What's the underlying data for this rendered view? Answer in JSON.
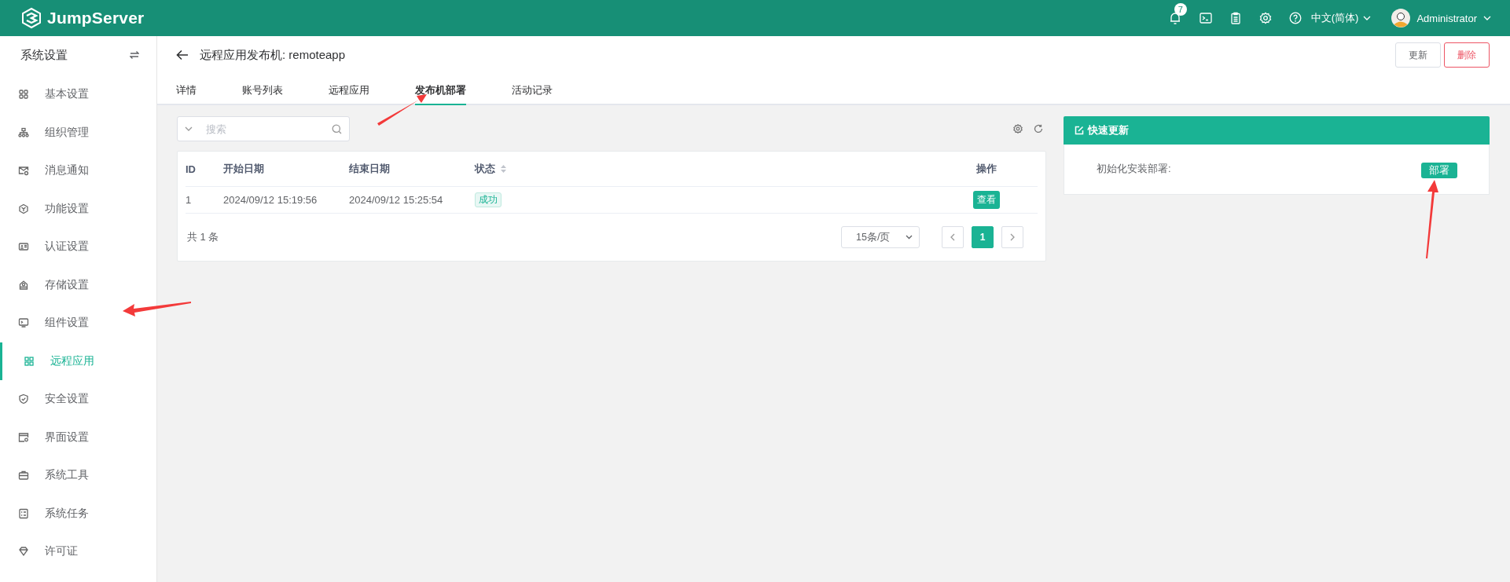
{
  "topbar": {
    "logo": "JumpServer",
    "notification_count": "7",
    "language": "中文(简体)",
    "user": "Administrator"
  },
  "sidebar": {
    "title": "系统设置",
    "items": [
      {
        "label": "基本设置",
        "selected": false
      },
      {
        "label": "组织管理",
        "selected": false
      },
      {
        "label": "消息通知",
        "selected": false
      },
      {
        "label": "功能设置",
        "selected": false
      },
      {
        "label": "认证设置",
        "selected": false
      },
      {
        "label": "存储设置",
        "selected": false
      },
      {
        "label": "组件设置",
        "selected": false
      },
      {
        "label": "远程应用",
        "selected": true
      },
      {
        "label": "安全设置",
        "selected": false
      },
      {
        "label": "界面设置",
        "selected": false
      },
      {
        "label": "系统工具",
        "selected": false
      },
      {
        "label": "系统任务",
        "selected": false
      },
      {
        "label": "许可证",
        "selected": false
      }
    ]
  },
  "header": {
    "title": "远程应用发布机: remoteapp",
    "buttons": [
      {
        "label": "更新",
        "kind": "default"
      },
      {
        "label": "删除",
        "kind": "danger"
      }
    ]
  },
  "tabs": [
    {
      "label": "详情",
      "selected": false
    },
    {
      "label": "账号列表",
      "selected": false
    },
    {
      "label": "远程应用",
      "selected": false
    },
    {
      "label": "发布机部署",
      "selected": true
    },
    {
      "label": "活动记录",
      "selected": false
    }
  ],
  "search": {
    "placeholder": "搜索"
  },
  "table": {
    "columns": [
      {
        "label": "ID",
        "sortable": false
      },
      {
        "label": "开始日期",
        "sortable": false
      },
      {
        "label": "结束日期",
        "sortable": false
      },
      {
        "label": "状态",
        "sortable": true
      },
      {
        "label": "操作",
        "sortable": false
      }
    ],
    "rows": [
      {
        "cells": [
          "1",
          "2024/09/12 15:19:56",
          "2024/09/12 15:25:54"
        ],
        "status": "成功",
        "action": "查看"
      }
    ]
  },
  "pagination": {
    "total": "共 1 条",
    "page_size": "15条/页",
    "pages": [
      {
        "label": "1",
        "selected": true
      }
    ]
  },
  "quick_update": {
    "title": "快速更新",
    "rows": [
      {
        "label": "初始化安装部署:",
        "action": "部署"
      }
    ]
  }
}
